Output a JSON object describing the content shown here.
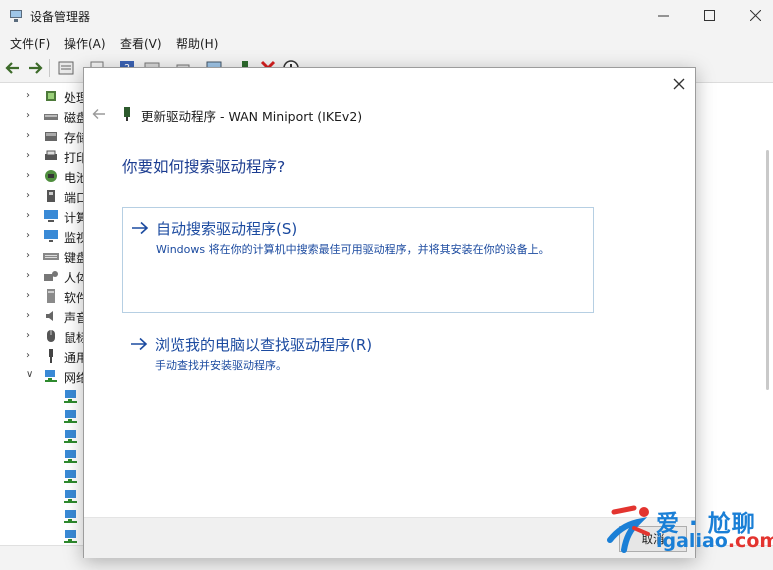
{
  "window": {
    "title": "设备管理器",
    "menu": [
      "文件(F)",
      "操作(A)",
      "查看(V)",
      "帮助(H)"
    ]
  },
  "tree": {
    "categories": [
      {
        "label": "处理",
        "icon": "processor-icon"
      },
      {
        "label": "磁盘",
        "icon": "disk-icon"
      },
      {
        "label": "存储",
        "icon": "storage-icon"
      },
      {
        "label": "打印",
        "icon": "printer-icon"
      },
      {
        "label": "电池",
        "icon": "battery-icon"
      },
      {
        "label": "端口",
        "icon": "port-icon"
      },
      {
        "label": "计算",
        "icon": "computer-icon"
      },
      {
        "label": "监视",
        "icon": "monitor-icon"
      },
      {
        "label": "键盘",
        "icon": "keyboard-icon"
      },
      {
        "label": "人体",
        "icon": "hid-icon"
      },
      {
        "label": "软件",
        "icon": "software-device-icon"
      },
      {
        "label": "声音",
        "icon": "sound-icon"
      },
      {
        "label": "鼠标",
        "icon": "mouse-icon"
      },
      {
        "label": "通用",
        "icon": "usb-icon"
      },
      {
        "label": "网络",
        "icon": "network-icon",
        "expanded": true
      }
    ],
    "network_children_count": 8
  },
  "dialog": {
    "title": "更新驱动程序 - WAN Miniport (IKEv2)",
    "heading": "你要如何搜索驱动程序?",
    "options": [
      {
        "title": "自动搜索驱动程序(S)",
        "description": "Windows 将在你的计算机中搜索最佳可用驱动程序，并将其安装在你的设备上。",
        "selected": true
      },
      {
        "title": "浏览我的电脑以查找驱动程序(R)",
        "description": "手动查找并安装驱动程序。",
        "selected": false
      }
    ],
    "cancel_label": "取消"
  },
  "watermark": {
    "cn": "爱 · 尬聊",
    "en_prefix": "igaliao",
    "en_suffix": ".com"
  },
  "colors": {
    "heading": "#1c3d91",
    "link": "#1c4ba0",
    "selected_border": "#b6cfe3",
    "watermark_blue": "#1a7fd6",
    "watermark_red": "#e3342f",
    "toolbar_delete_red": "#d42020"
  }
}
